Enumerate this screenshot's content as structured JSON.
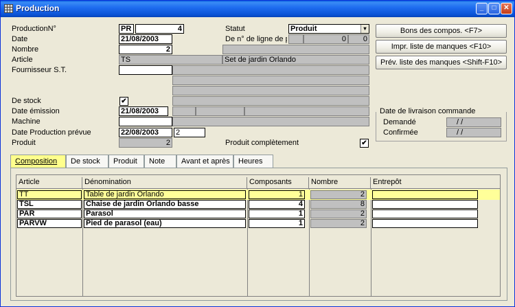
{
  "window": {
    "title": "Production"
  },
  "titlebar_buttons": {
    "minimize": "_",
    "maximize": "□",
    "close": "✕"
  },
  "form": {
    "production_no_label": "ProductionN°",
    "production_prefix": "PR",
    "production_no": "4",
    "date_label": "Date",
    "date": "21/08/2003",
    "nombre_label": "Nombre",
    "nombre": "2",
    "article_label": "Article",
    "article_code": "TS",
    "article_desc": "Set de jardin Orlando",
    "fournisseur_label": "Fournisseur S.T.",
    "de_stock_label": "De stock",
    "de_stock_checked": "✔",
    "date_emission_label": "Date émission",
    "date_emission": "21/08/2003",
    "machine_label": "Machine",
    "date_prod_label": "Date Production prévue",
    "date_prod": "22/08/2003",
    "date_prod_extra": "2",
    "produit_label": "Produit",
    "produit_value": "2",
    "statut_label": "Statut",
    "statut_value": "Produit",
    "ligne_label": "De n° de ligne de pro",
    "ligne_val1": "0",
    "ligne_val2": "0",
    "produit_completement_label": "Produit complètement",
    "produit_completement_checked": "✔"
  },
  "buttons": {
    "bons": "Bons des compos. <F7>",
    "impr": "Impr. liste de manques <F10>",
    "prev": "Prév. liste des manques <Shift-F10>"
  },
  "livraison": {
    "title": "Date de livraison commande",
    "demande_label": "Demandé",
    "demande_value": "/ /",
    "confirmee_label": "Confirmée",
    "confirmee_value": "/ /"
  },
  "tabs": [
    "Composition",
    "De stock",
    "Produit",
    "Note",
    "Avant et après",
    "Heures"
  ],
  "tab_active": "Composition",
  "table": {
    "columns": [
      "Article",
      "Dénomination",
      "Composants",
      "Nombre",
      "Entrepôt"
    ],
    "rows": [
      {
        "article": "TT",
        "denomination": "Table de jardin Orlando",
        "composants": "1",
        "nombre": "2",
        "entrepot": ""
      },
      {
        "article": "TSL",
        "denomination": "Chaise de jardin Orlando basse",
        "composants": "4",
        "nombre": "8",
        "entrepot": ""
      },
      {
        "article": "PAR",
        "denomination": "Parasol",
        "composants": "1",
        "nombre": "2",
        "entrepot": ""
      },
      {
        "article": "PARVW",
        "denomination": "Pied de parasol (eau)",
        "composants": "1",
        "nombre": "2",
        "entrepot": ""
      }
    ]
  }
}
